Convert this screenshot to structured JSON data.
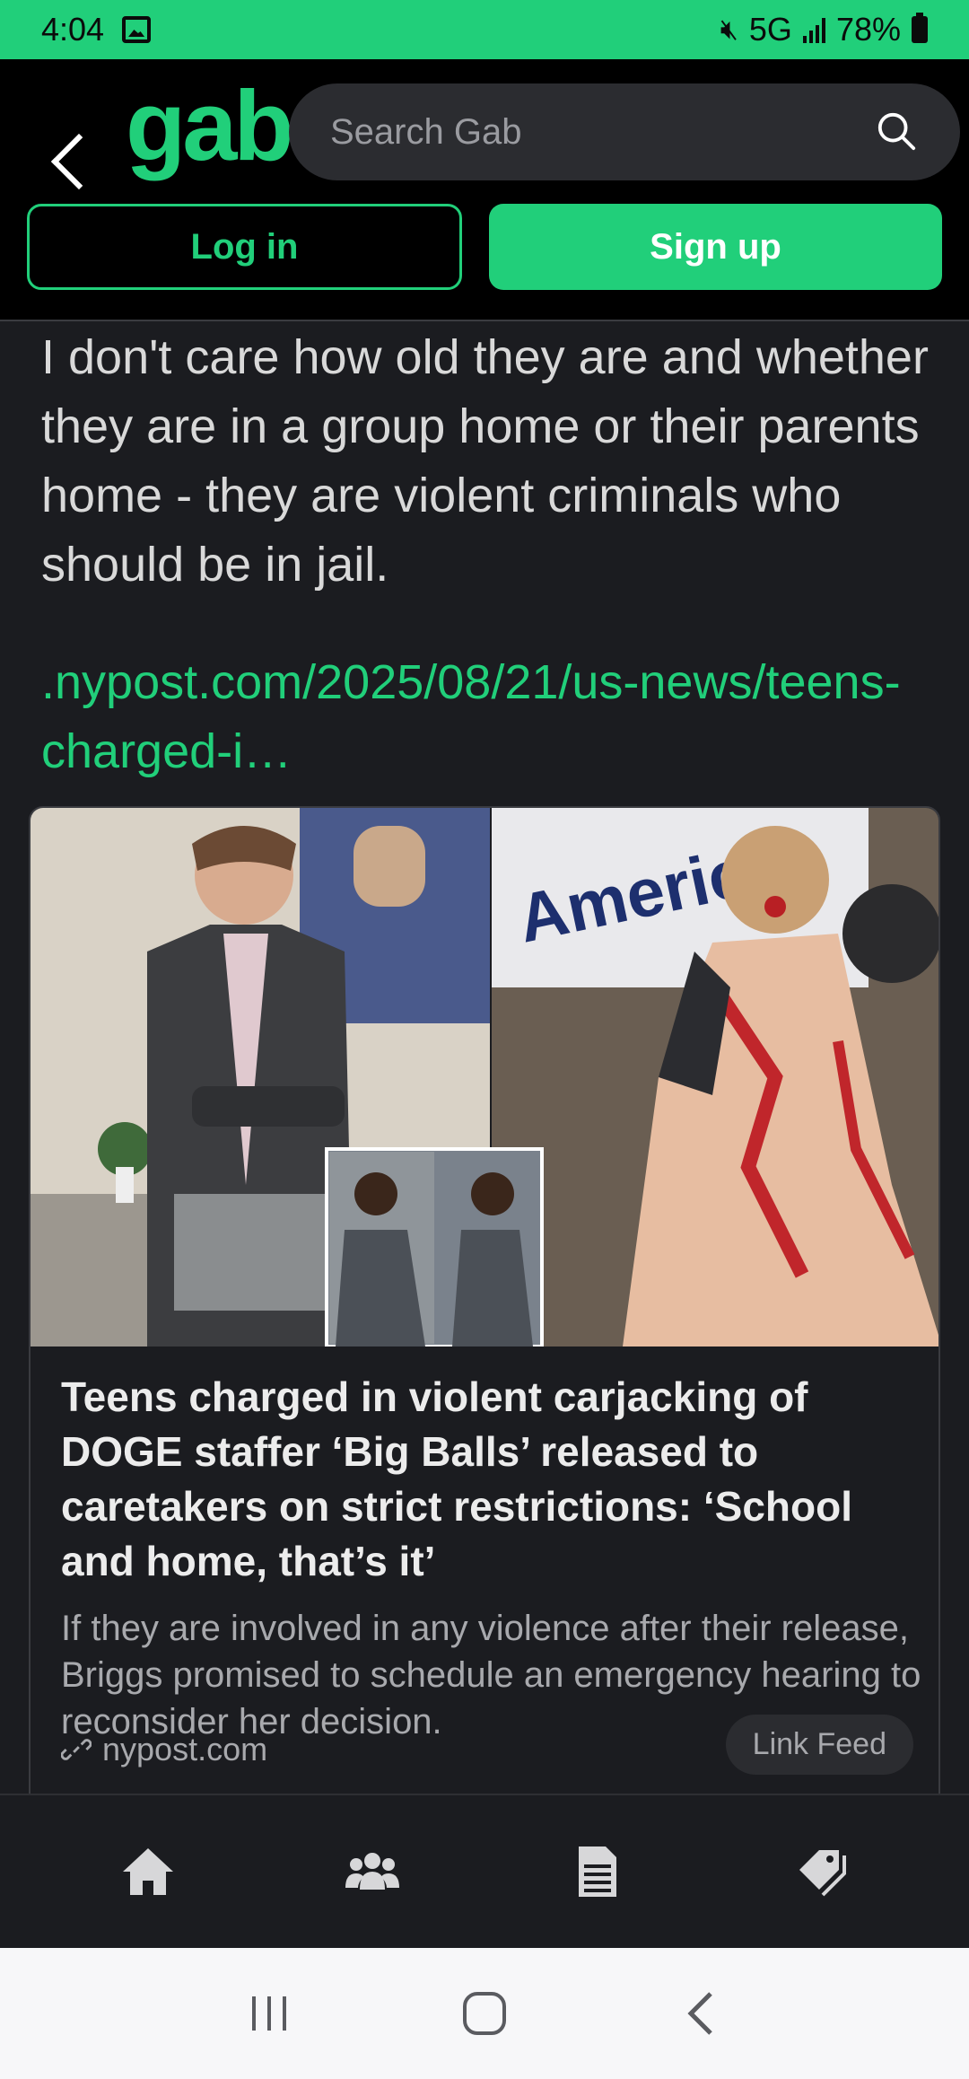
{
  "status_bar": {
    "time": "4:04",
    "network": "5G",
    "battery": "78%"
  },
  "header": {
    "logo": "gab",
    "search_placeholder": "Search Gab",
    "login_label": "Log in",
    "signup_label": "Sign up"
  },
  "post": {
    "text": "I don't care how old they are and whether they are in a group home or their parents home - they are violent criminals who should be in jail.",
    "link_text": ".nypost.com/2025/08/21/us-news/teens-charged-i…"
  },
  "card": {
    "image_text": "American",
    "title": "Teens charged in violent carjacking of DOGE staffer ‘Big Balls’ released to caretakers on strict restrictions: ‘School and home, that’s it’",
    "description": "If they are involved in any violence after their release, Briggs promised to schedule an emergency hearing to reconsider her decision.",
    "domain": "nypost.com",
    "feed_button": "Link Feed"
  },
  "bottom_nav": {
    "items": [
      {
        "icon": "home-icon"
      },
      {
        "icon": "groups-icon"
      },
      {
        "icon": "news-icon"
      },
      {
        "icon": "tag-icon"
      }
    ]
  },
  "colors": {
    "accent": "#21cf7a",
    "background": "#1b1c20",
    "header": "#000000"
  }
}
